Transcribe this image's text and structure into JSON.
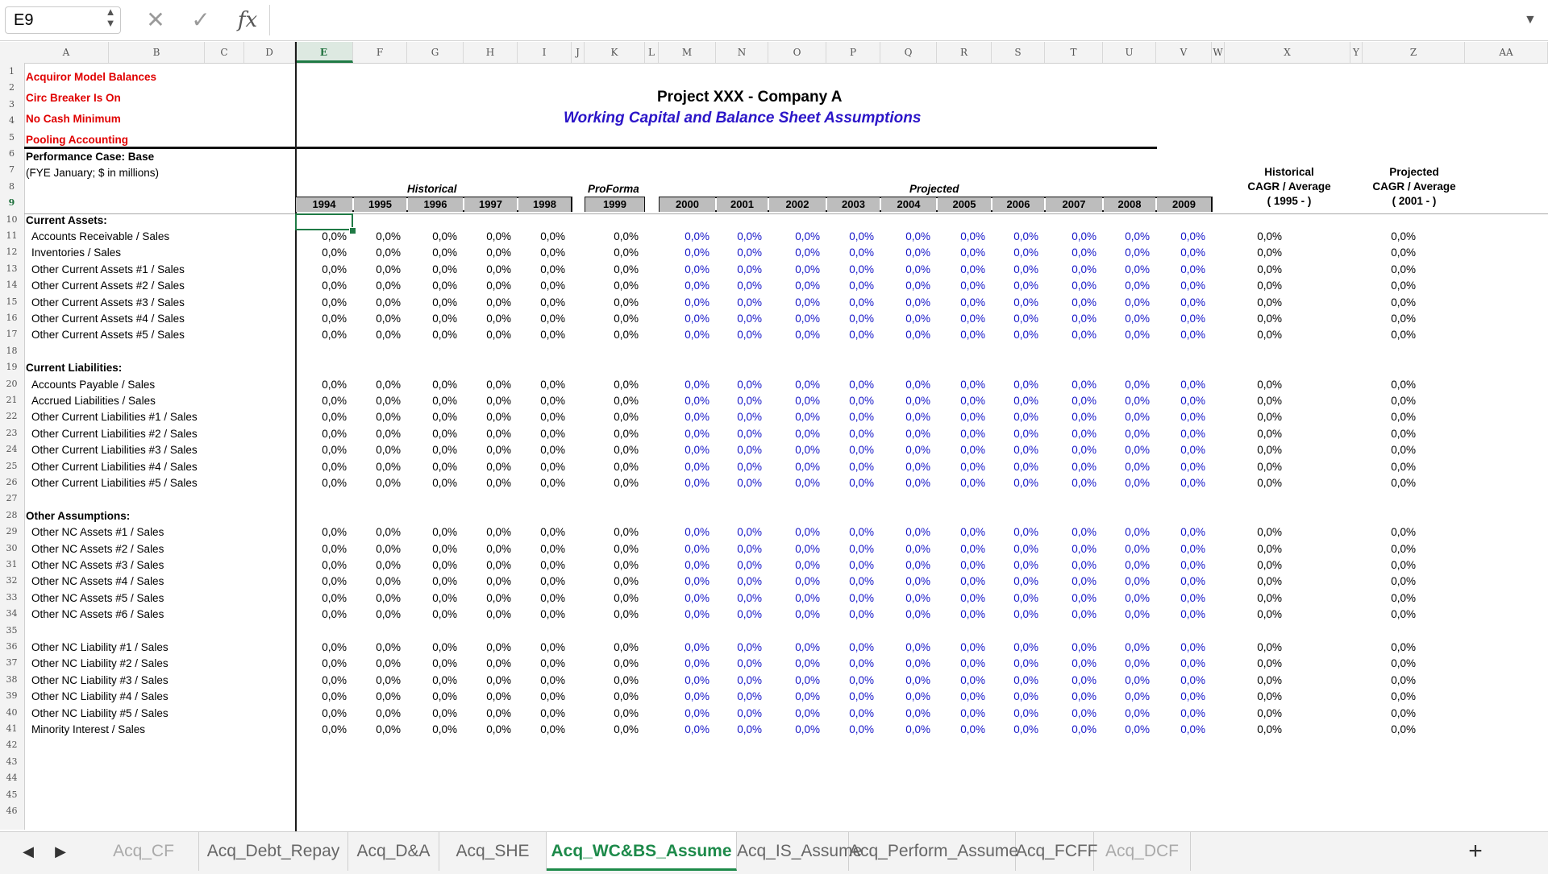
{
  "formula_bar": {
    "name_box": "E9",
    "cancel_glyph": "✕",
    "enter_glyph": "✓",
    "fx_label": "fx",
    "formula": ""
  },
  "columns": [
    "A",
    "B",
    "C",
    "D",
    "E",
    "F",
    "G",
    "H",
    "I",
    "J",
    "K",
    "L",
    "M",
    "N",
    "O",
    "P",
    "Q",
    "R",
    "S",
    "T",
    "U",
    "V",
    "W",
    "X",
    "Y",
    "Z",
    "AA"
  ],
  "selected_column": "E",
  "selected_row": "9",
  "flags": {
    "line1": "Acquiror Model Balances",
    "line2": "Circ Breaker Is On",
    "line3": "No Cash Minimum",
    "line4": "Pooling Accounting"
  },
  "performance_case": "Performance Case: Base",
  "units_note": "(FYE January; $ in millions)",
  "title": "Project XXX - Company A",
  "subtitle": "Working Capital and Balance Sheet Assumptions",
  "groups": {
    "historical": "Historical",
    "proforma": "ProForma",
    "projected": "Projected"
  },
  "years": {
    "historical": [
      "1994",
      "1995",
      "1996",
      "1997",
      "1998"
    ],
    "proforma": [
      "1999"
    ],
    "projected": [
      "2000",
      "2001",
      "2002",
      "2003",
      "2004",
      "2005",
      "2006",
      "2007",
      "2008",
      "2009"
    ]
  },
  "cagr": {
    "historical": {
      "line1": "Historical",
      "line2": "CAGR / Average",
      "line3": "( 1995 - )"
    },
    "projected": {
      "line1": "Projected",
      "line2": "CAGR / Average",
      "line3": "( 2001 - )"
    }
  },
  "sections": [
    {
      "header": "Current Assets:",
      "rows": [
        "Accounts Receivable / Sales",
        "Inventories / Sales",
        "Other Current Assets #1 / Sales",
        "Other Current Assets #2 / Sales",
        "Other Current Assets #3 / Sales",
        "Other Current Assets #4 / Sales",
        "Other Current Assets #5 / Sales"
      ]
    },
    {
      "header": "Current Liabilities:",
      "rows": [
        "Accounts Payable / Sales",
        "Accrued Liabilities / Sales",
        "Other Current Liabilities #1 / Sales",
        "Other Current Liabilities #2 / Sales",
        "Other Current Liabilities #3 / Sales",
        "Other Current Liabilities #4 / Sales",
        "Other Current Liabilities #5 / Sales"
      ]
    },
    {
      "header": "Other Assumptions:",
      "rows": [
        "Other NC Assets #1 / Sales",
        "Other NC Assets #2 / Sales",
        "Other NC Assets #3 / Sales",
        "Other NC Assets #4 / Sales",
        "Other NC Assets #5 / Sales",
        "Other NC Assets #6 / Sales"
      ]
    },
    {
      "header": "",
      "rows": [
        "Other NC Liability #1 / Sales",
        "Other NC Liability #2 / Sales",
        "Other NC Liability #3 / Sales",
        "Other NC Liability #4 / Sales",
        "Other NC Liability #5 / Sales",
        "Minority Interest / Sales"
      ]
    }
  ],
  "cell_value": "0,0%",
  "row_numbers": [
    "1",
    "2",
    "3",
    "4",
    "5",
    "6",
    "7",
    "8",
    "9",
    "10",
    "11",
    "12",
    "13",
    "14",
    "15",
    "16",
    "17",
    "18",
    "19",
    "20",
    "21",
    "22",
    "23",
    "24",
    "25",
    "26",
    "27",
    "28",
    "29",
    "30",
    "31",
    "32",
    "33",
    "34",
    "35",
    "36",
    "37",
    "38",
    "39",
    "40",
    "41",
    "42",
    "43",
    "44",
    "45",
    "46"
  ],
  "sheet_tabs": [
    "Acq_CF",
    "Acq_Debt_Repay",
    "Acq_D&A",
    "Acq_SHE",
    "Acq_WC&BS_Assume",
    "Acq_IS_Assume",
    "Acq_Perform_Assume",
    "Acq_FCFF",
    "Acq_DCF"
  ],
  "active_tab": "Acq_WC&BS_Assume",
  "tab_nav": {
    "prev": "◀",
    "next": "▶",
    "add": "+"
  },
  "colors": {
    "accent": "#1d8a4a",
    "flag_red": "#e00000",
    "projected_blue": "#1414c8",
    "subtitle_purple": "#2b15c8"
  }
}
